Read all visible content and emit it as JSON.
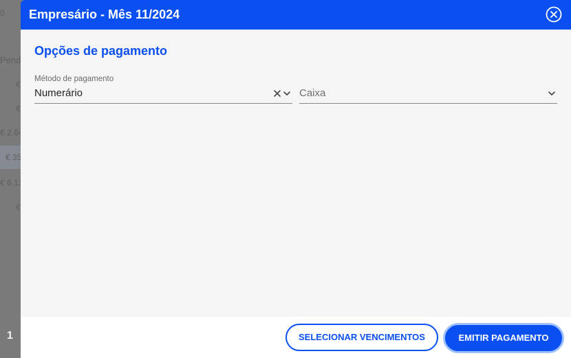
{
  "background": {
    "rows": [
      "0",
      "Pend",
      "€",
      "€",
      "€ 2.64",
      "€ 35",
      "€ 6.13",
      "€"
    ],
    "page_number": "1"
  },
  "modal": {
    "title": "Empresário - Mês 11/2024",
    "close_icon": "close-circle-icon",
    "section_title": "Opções de pagamento",
    "payment_method": {
      "label": "Método de pagamento",
      "value": "Numerário",
      "icons": [
        "clear-icon",
        "chevron-down-icon"
      ]
    },
    "cash_account": {
      "placeholder": "Caixa",
      "icons": [
        "chevron-down-icon"
      ]
    },
    "footer": {
      "select_due_dates_label": "SELECIONAR VENCIMENTOS",
      "issue_payment_label": "EMITIR PAGAMENTO"
    }
  },
  "colors": {
    "accent": "#0a4ff0",
    "overlay": "#7a7a7a",
    "modal_bg": "#f5f5f5"
  }
}
